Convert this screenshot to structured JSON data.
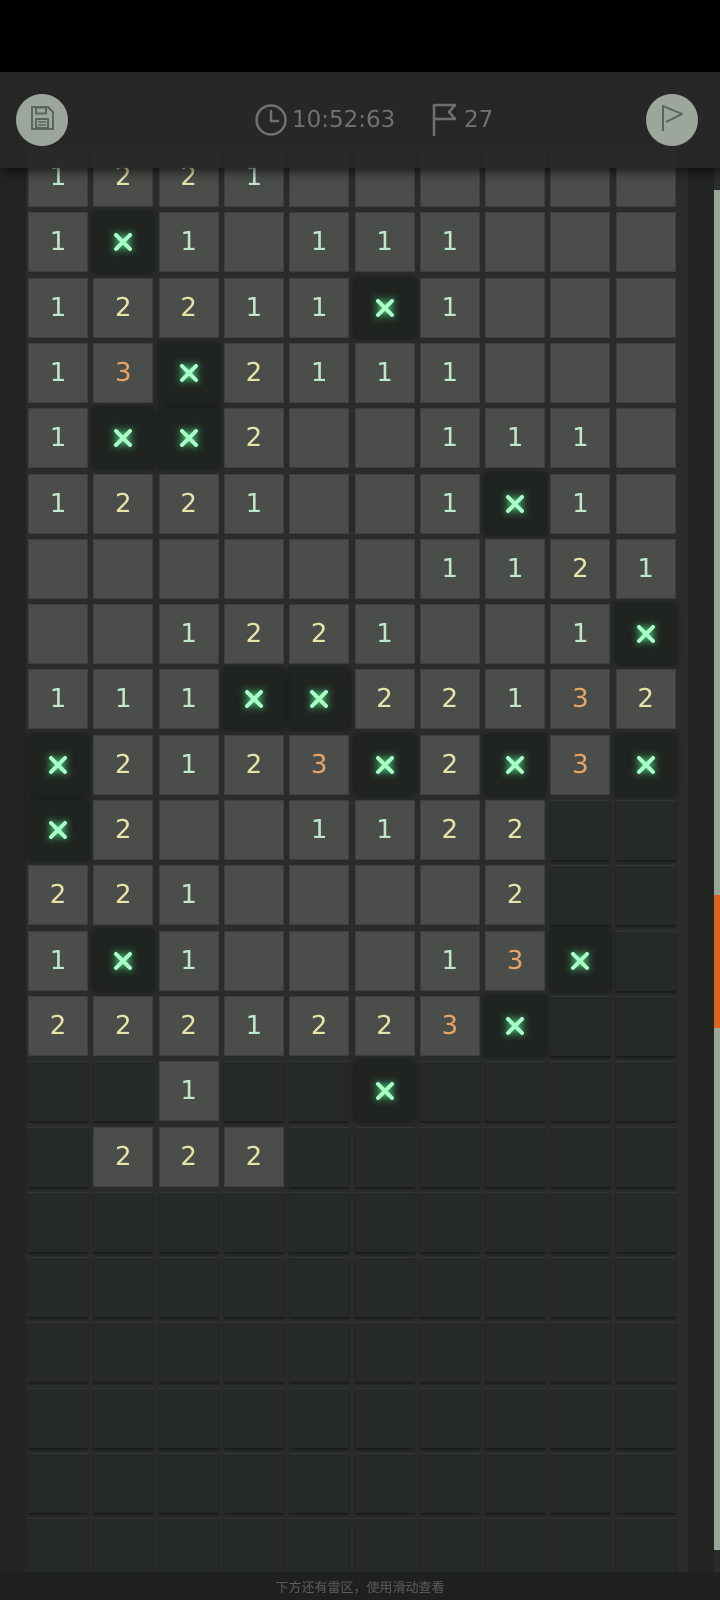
{
  "toolbar": {
    "timer": "10:52:63",
    "flag_count": "27",
    "icons": {
      "save": "save-icon",
      "clock": "clock-icon",
      "flag": "flag-icon",
      "flag_mode": "flag-mode-icon"
    }
  },
  "footer_hint": "下方还有雷区，使用滑动查看",
  "colors": {
    "n1": "#bfe7c9",
    "n2": "#e8e3a6",
    "n3": "#e6a566",
    "mine_glow": "#5dff9a",
    "scroll_thumb": "#d8661c"
  },
  "board": {
    "legend": {
      "digits": "revealed number",
      "X": "revealed mine",
      "_": "revealed empty",
      "#": "hidden tile"
    },
    "rows": [
      [
        "1",
        "2",
        "2",
        "1",
        "_",
        "_",
        "_",
        "_",
        "_",
        "_"
      ],
      [
        "1",
        "X",
        "1",
        "_",
        "1",
        "1",
        "1",
        "_",
        "_",
        "_"
      ],
      [
        "1",
        "2",
        "2",
        "1",
        "1",
        "X",
        "1",
        "_",
        "_",
        "_"
      ],
      [
        "1",
        "3",
        "X",
        "2",
        "1",
        "1",
        "1",
        "_",
        "_",
        "_"
      ],
      [
        "1",
        "X",
        "X",
        "2",
        "_",
        "_",
        "1",
        "1",
        "1",
        "_"
      ],
      [
        "1",
        "2",
        "2",
        "1",
        "_",
        "_",
        "1",
        "X",
        "1",
        "_"
      ],
      [
        "_",
        "_",
        "_",
        "_",
        "_",
        "_",
        "1",
        "1",
        "2",
        "1"
      ],
      [
        "_",
        "_",
        "1",
        "2",
        "2",
        "1",
        "_",
        "_",
        "1",
        "X"
      ],
      [
        "1",
        "1",
        "1",
        "X",
        "X",
        "2",
        "2",
        "1",
        "3",
        "2"
      ],
      [
        "X",
        "2",
        "1",
        "2",
        "3",
        "X",
        "2",
        "X",
        "3",
        "X"
      ],
      [
        "X",
        "2",
        "_",
        "_",
        "1",
        "1",
        "2",
        "2",
        "#",
        "#"
      ],
      [
        "2",
        "2",
        "1",
        "_",
        "_",
        "_",
        "_",
        "2",
        "#",
        "#"
      ],
      [
        "1",
        "X",
        "1",
        "_",
        "_",
        "_",
        "1",
        "3",
        "X",
        "#"
      ],
      [
        "2",
        "2",
        "2",
        "1",
        "2",
        "2",
        "3",
        "X",
        "#",
        "#"
      ],
      [
        "#",
        "#",
        "1",
        "#",
        "#",
        "X",
        "#",
        "#",
        "#",
        "#"
      ],
      [
        "#",
        "2",
        "2",
        "2",
        "#",
        "#",
        "#",
        "#",
        "#",
        "#"
      ],
      [
        "#",
        "#",
        "#",
        "#",
        "#",
        "#",
        "#",
        "#",
        "#",
        "#"
      ],
      [
        "#",
        "#",
        "#",
        "#",
        "#",
        "#",
        "#",
        "#",
        "#",
        "#"
      ],
      [
        "#",
        "#",
        "#",
        "#",
        "#",
        "#",
        "#",
        "#",
        "#",
        "#"
      ],
      [
        "#",
        "#",
        "#",
        "#",
        "#",
        "#",
        "#",
        "#",
        "#",
        "#"
      ],
      [
        "#",
        "#",
        "#",
        "#",
        "#",
        "#",
        "#",
        "#",
        "#",
        "#"
      ],
      [
        "#",
        "#",
        "#",
        "#",
        "#",
        "#",
        "#",
        "#",
        "#",
        "#"
      ]
    ]
  }
}
